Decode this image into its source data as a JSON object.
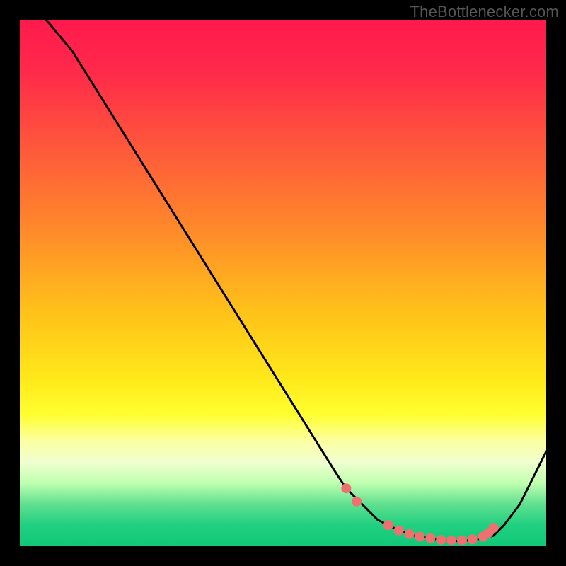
{
  "watermark": "TheBottlenecker.com",
  "chart_data": {
    "type": "line",
    "title": "",
    "xlabel": "",
    "ylabel": "",
    "xlim": [
      0,
      100
    ],
    "ylim": [
      0,
      100
    ],
    "grid": false,
    "series": [
      {
        "name": "curve",
        "x": [
          5,
          10,
          15,
          20,
          25,
          30,
          35,
          40,
          45,
          50,
          55,
          60,
          62,
          65,
          68,
          72,
          75,
          78,
          80,
          82,
          84,
          86,
          88,
          90,
          92,
          95,
          100
        ],
        "y": [
          100,
          94,
          86,
          78,
          70,
          62,
          54,
          46,
          38,
          30,
          22,
          14,
          11,
          8,
          5,
          3,
          2,
          1.5,
          1.2,
          1,
          1,
          1.2,
          1.5,
          2,
          4,
          8,
          18
        ]
      }
    ],
    "markers": [
      {
        "x": 62,
        "y": 11
      },
      {
        "x": 64,
        "y": 8.5
      },
      {
        "x": 70,
        "y": 4
      },
      {
        "x": 72,
        "y": 3
      },
      {
        "x": 74,
        "y": 2.3
      },
      {
        "x": 76,
        "y": 1.8
      },
      {
        "x": 78,
        "y": 1.5
      },
      {
        "x": 80,
        "y": 1.2
      },
      {
        "x": 82,
        "y": 1.1
      },
      {
        "x": 84,
        "y": 1.1
      },
      {
        "x": 86,
        "y": 1.3
      },
      {
        "x": 88,
        "y": 1.8
      },
      {
        "x": 89,
        "y": 2.5
      },
      {
        "x": 90,
        "y": 3.5
      }
    ],
    "gradient_stops": [
      {
        "offset": 0.0,
        "color": "#ff1a4d"
      },
      {
        "offset": 0.1,
        "color": "#ff2a4a"
      },
      {
        "offset": 0.25,
        "color": "#ff5a3a"
      },
      {
        "offset": 0.4,
        "color": "#ff8a2a"
      },
      {
        "offset": 0.55,
        "color": "#ffc01a"
      },
      {
        "offset": 0.68,
        "color": "#ffe81a"
      },
      {
        "offset": 0.75,
        "color": "#ffff30"
      },
      {
        "offset": 0.8,
        "color": "#fcffa0"
      },
      {
        "offset": 0.84,
        "color": "#f0ffd0"
      },
      {
        "offset": 0.88,
        "color": "#c0ffb0"
      },
      {
        "offset": 0.92,
        "color": "#60e090"
      },
      {
        "offset": 0.96,
        "color": "#20d080"
      },
      {
        "offset": 1.0,
        "color": "#10c878"
      }
    ],
    "marker_color": "#f07070",
    "line_color": "#000000"
  }
}
